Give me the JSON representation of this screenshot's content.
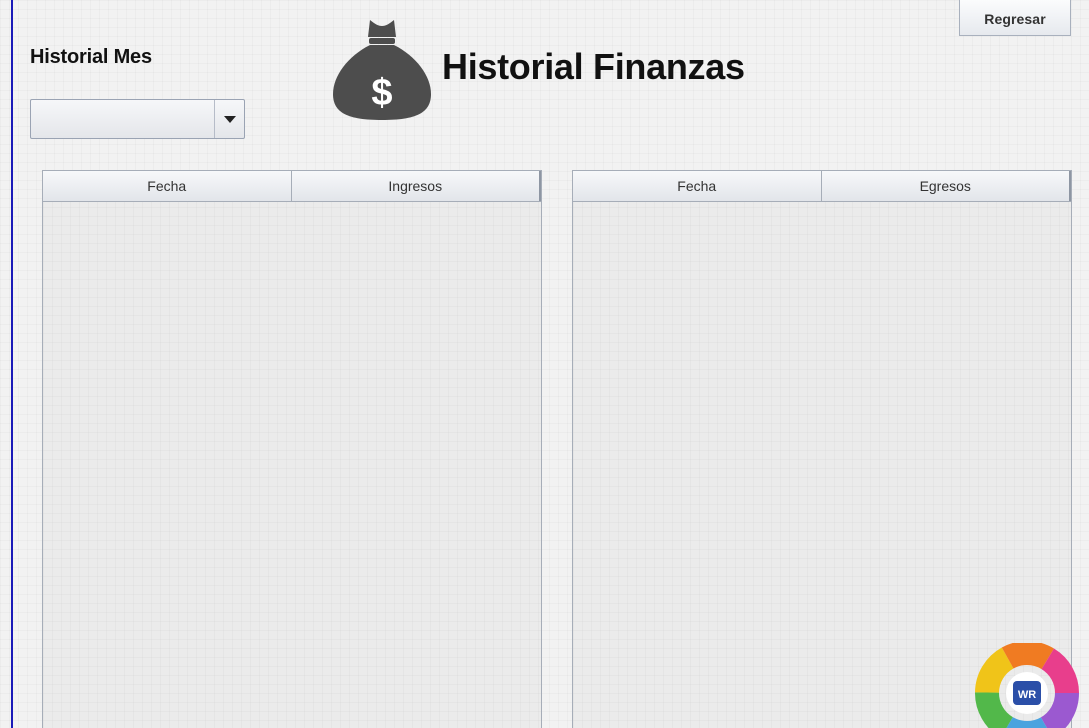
{
  "header": {
    "month_label": "Historial Mes",
    "title": "Historial Finanzas",
    "back_button": "Regresar",
    "title_icon": "money-bag-icon"
  },
  "month_selector": {
    "value": "",
    "arrow_icon": "chevron-down-icon"
  },
  "income_table": {
    "columns": [
      "Fecha",
      "Ingresos"
    ],
    "rows": []
  },
  "expense_table": {
    "columns": [
      "Fecha",
      "Egresos"
    ],
    "rows": []
  },
  "logo": {
    "text": "WR",
    "icon": "colorful-ring-logo"
  },
  "colors": {
    "window_border": "#1a1ab8",
    "icon_fill": "#4d4d4d",
    "background": "#f2f2f2"
  }
}
